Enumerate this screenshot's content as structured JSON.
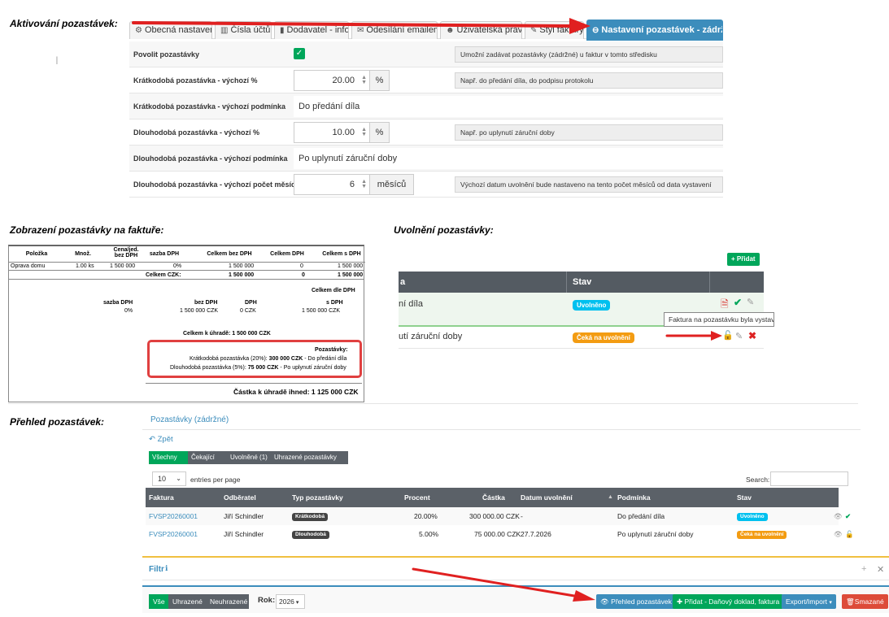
{
  "sections": {
    "activation": "Aktivování pozastávek:",
    "invoice_display": "Zobrazení pozastávky na faktuře:",
    "release": "Uvolnění pozastávky:",
    "overview": "Přehled pozastávek:"
  },
  "settings": {
    "tabs": [
      {
        "label": "Obecná nastavení",
        "icon": "gears-icon"
      },
      {
        "label": "Čísla účtů",
        "icon": "bank-icon"
      },
      {
        "label": "Dodavatel - info",
        "icon": "book-icon"
      },
      {
        "label": "Odesílání emailem",
        "icon": "envelope-icon"
      },
      {
        "label": "Uživatelská práva",
        "icon": "users-icon"
      },
      {
        "label": "Styl faktury",
        "icon": "brush-icon"
      },
      {
        "label": "Nastavení pozastávek - zádržné",
        "icon": "circle-minus-icon"
      }
    ],
    "rows": [
      {
        "label": "Povolit pozastávky",
        "hint": "Umožní zadávat pozastávky (zádržné) u faktur v tomto středisku"
      },
      {
        "label": "Krátkodobá pozastávka - výchozí %",
        "value": "20.00",
        "unit": "%",
        "hint": "Např. do předání díla, do podpisu protokolu"
      },
      {
        "label": "Krátkodobá pozastávka - výchozí podmínka",
        "value": "Do předání díla"
      },
      {
        "label": "Dlouhodobá pozastávka - výchozí %",
        "value": "10.00",
        "unit": "%",
        "hint": "Např. po uplynutí záruční doby"
      },
      {
        "label": "Dlouhodobá pozastávka - výchozí podmínka",
        "value": "Po uplynutí záruční doby"
      },
      {
        "label": "Dlouhodobá pozastávka - výchozí počet měsíců",
        "value": "6",
        "unit": "měsíců",
        "hint": "Výchozí datum uvolnění bude nastaveno na tento počet měsíců od data vystavení"
      }
    ]
  },
  "invoice": {
    "headers": [
      "Položka",
      "Množ.",
      "Cena/jed. bez DPH",
      "sazba DPH",
      "Celkem bez DPH",
      "Celkem DPH",
      "Celkem s DPH"
    ],
    "row": [
      "Oprava domu",
      "1.00 ks",
      "1 500 000",
      "0%",
      "1 500 000",
      "0",
      "1 500 000"
    ],
    "total_label": "Celkem CZK:",
    "total_values": [
      "1 500 000",
      "0",
      "1 500 000"
    ],
    "vat_title": "Celkem dle DPH",
    "vat_headers": [
      "sazba DPH",
      "bez DPH",
      "DPH",
      "s DPH"
    ],
    "vat_row": [
      "0%",
      "1 500 000 CZK",
      "0 CZK",
      "1 500 000 CZK"
    ],
    "to_pay": "Celkem k úhradě: 1 500 000 CZK",
    "retention_title": "Pozastávky:",
    "retention_short_pre": "Krátkodobá pozastávka (20%): ",
    "retention_short_amount": "300 000 CZK",
    "retention_short_post": " - Do předání díla",
    "retention_long_pre": "Dlouhodobá pozastávka (5%): ",
    "retention_long_amount": "75 000 CZK",
    "retention_long_post": " - Po uplynutí záruční doby",
    "pay_now": "Částka k úhradě ihned: 1 125 000 CZK"
  },
  "release": {
    "add_label": "+ Přidat",
    "col_left": "a",
    "col_status": "Stav",
    "rows": [
      {
        "text": "ní díla",
        "status": "Uvolněno",
        "status_color": "#00c0ef"
      },
      {
        "text": "utí záruční doby",
        "status": "Čeká na uvolnění",
        "status_color": "#f39c12"
      }
    ],
    "tooltip": "Faktura na pozastávku byla vystavena"
  },
  "overview": {
    "panel_title": "Pozastávky (zádržné)",
    "back": "Zpět",
    "filters": [
      "Všechny (2)",
      "Čekající (1)",
      "Uvolněné (1)",
      "Uhrazené pozastávky (0)"
    ],
    "page_size": "10",
    "entries_label": "entries per page",
    "search_label": "Search:",
    "columns": [
      "Faktura",
      "Odběratel",
      "Typ pozastávky",
      "Procent",
      "Částka",
      "Datum uvolnění",
      "Podmínka",
      "Stav"
    ],
    "rows": [
      {
        "invoice": "FVSP20260001",
        "customer": "Jiří Schindler",
        "type": "Krátkodobá",
        "percent": "20.00%",
        "amount": "300 000.00 CZK",
        "date": "-",
        "condition": "Do předání díla",
        "status": "Uvolněno",
        "status_color": "#00c0ef"
      },
      {
        "invoice": "FVSP20260001",
        "customer": "Jiří Schindler",
        "type": "Dlouhodobá",
        "percent": "5.00%",
        "amount": "75 000.00 CZK",
        "date": "27.7.2026",
        "condition": "Po uplynutí záruční doby",
        "status": "Čeká na uvolnění",
        "status_color": "#f39c12"
      }
    ]
  },
  "filter_panel": {
    "title": "Filtr",
    "pay_filters": [
      "Vše",
      "Uhrazené",
      "Neuhrazené"
    ],
    "year_label": "Rok:",
    "year_value": "2026",
    "buttons": {
      "overview": "Přehled pozastávek",
      "add": "Přidat - Daňový doklad, faktura",
      "export": "Export/Import",
      "deleted": "Smazané"
    }
  }
}
